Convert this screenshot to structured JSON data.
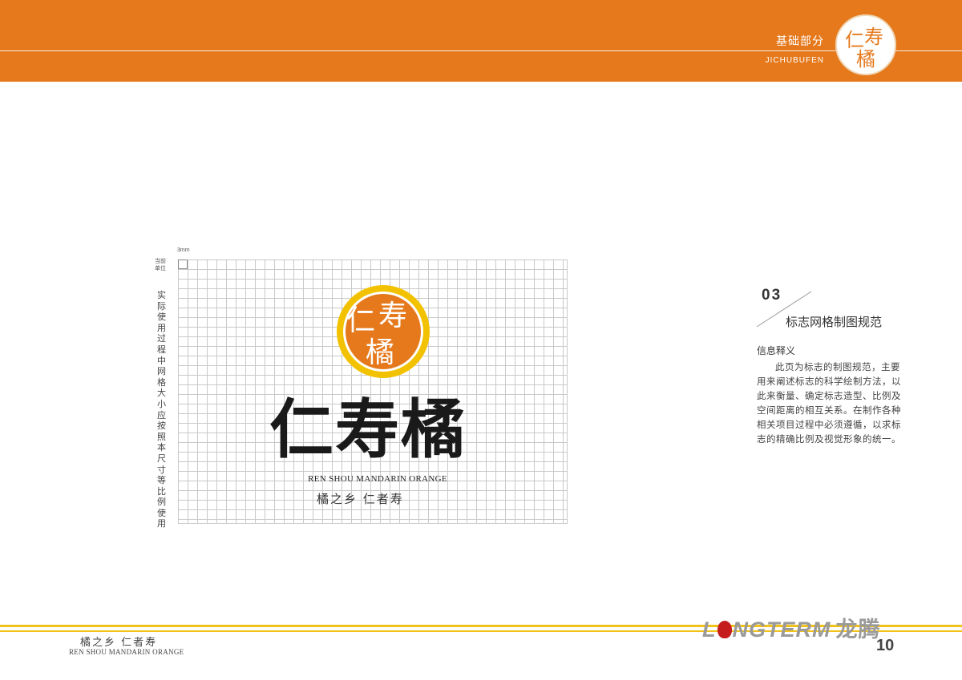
{
  "header": {
    "section_cn": "基础部分",
    "section_en": "JICHUBUFEN",
    "accent_color": "#e5791c",
    "seal_chars": [
      "仁",
      "寿",
      "橘"
    ]
  },
  "grid_area": {
    "unit_label": "当前单位",
    "unit_value": "3mm",
    "vertical_note": "实际使用过程中网格大小应按照本尺寸等比例使用"
  },
  "logo": {
    "emblem_chars": [
      "仁",
      "寿",
      "橘"
    ],
    "emblem_color": "#e5791c",
    "ring_color": "#f2c200",
    "wordmark": "仁寿橘",
    "english": "REN SHOU MANDARIN ORANGE",
    "slogan": "橘之乡   仁者寿"
  },
  "section": {
    "number": "03",
    "title": "标志网格制图规范",
    "info_heading": "信息释义",
    "info_body": "此页为标志的制图规范，主要用来阐述标志的科学绘制方法，以此来衡量、确定标志造型、比例及空间距离的相互关系。在制作各种相关项目过程中必须遵循，以求标志的精确比例及视觉形象的统一。"
  },
  "footer": {
    "slogan_cn": "橘之乡   仁者寿",
    "slogan_en": "REN SHOU  MANDARIN ORANGE",
    "brand_pre": "L",
    "brand_post": "NGTERM",
    "brand_cn": "龙腾",
    "page_number": "10",
    "line_color": "#f0c21a"
  }
}
